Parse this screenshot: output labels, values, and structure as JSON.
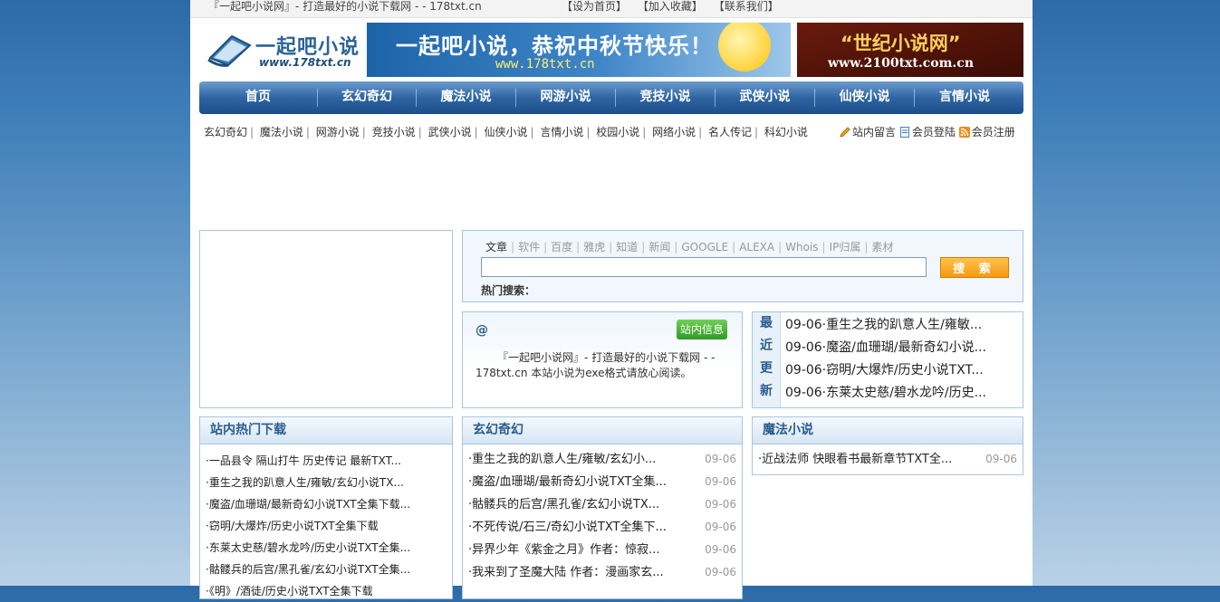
{
  "topbar": {
    "site_title": "『一起吧小说网』- 打造最好的小说下载网 - - 178txt.cn",
    "links": [
      "【设为首页】",
      "【加入收藏】",
      "【联系我们】"
    ]
  },
  "logo": {
    "brand": "一起吧小说",
    "url": "www.178txt.cn"
  },
  "banner1": {
    "headline": "一起吧小说，恭祝中秋节快乐！",
    "url": "www.178txt.cn"
  },
  "banner2": {
    "headline": "“世纪小说网”",
    "url": "www.2100txt.com.cn"
  },
  "nav": [
    "首页",
    "玄幻奇幻",
    "魔法小说",
    "网游小说",
    "竞技小说",
    "武侠小说",
    "仙侠小说",
    "言情小说"
  ],
  "categories": [
    "玄幻奇幻",
    "魔法小说",
    "网游小说",
    "竞技小说",
    "武侠小说",
    "仙侠小说",
    "言情小说",
    "校园小说",
    "网络小说",
    "名人传记",
    "科幻小说"
  ],
  "user_links": {
    "guestbook": "站内留言",
    "login": "会员登陆",
    "register": "会员注册"
  },
  "search": {
    "tabs": [
      "文章",
      "软件",
      "百度",
      "雅虎",
      "知道",
      "新闻",
      "GOOGLE",
      "ALEXA",
      "Whois",
      "IP归属",
      "素材"
    ],
    "input_value": "",
    "button": "搜 索",
    "hot_label": "热门搜索："
  },
  "site_info": {
    "at_symbol": "@",
    "badge": "站内信息",
    "description": "『一起吧小说网』- 打造最好的小说下载网 - - 178txt.cn 本站小说为exe格式请放心阅读。"
  },
  "recent": {
    "side_label": [
      "最",
      "近",
      "更",
      "新"
    ],
    "items": [
      "09-06·重生之我的趴意人生/雍敏...",
      "09-06·魔盗/血珊瑚/最新奇幻小说...",
      "09-06·窃明/大爆炸/历史小说TXT...",
      "09-06·东莱太史慈/碧水龙吟/历史..."
    ]
  },
  "hot_downloads": {
    "title": "站内热门下载",
    "items": [
      "·一品县令 隔山打牛 历史传记 最新TXT...",
      "·重生之我的趴意人生/雍敏/玄幻小说TX...",
      "·魔盗/血珊瑚/最新奇幻小说TXT全集下载...",
      "·窃明/大爆炸/历史小说TXT全集下载",
      "·东莱太史慈/碧水龙吟/历史小说TXT全集...",
      "·骷髅兵的后宫/黑孔雀/玄幻小说TXT全集...",
      "·《明》/酒徒/历史小说TXT全集下载"
    ]
  },
  "xuanhuan": {
    "title": "玄幻奇幻",
    "items": [
      {
        "title": "·重生之我的趴意人生/雍敏/玄幻小...",
        "date": "09-06"
      },
      {
        "title": "·魔盗/血珊瑚/最新奇幻小说TXT全集...",
        "date": "09-06"
      },
      {
        "title": "·骷髅兵的后宫/黑孔雀/玄幻小说TX...",
        "date": "09-06"
      },
      {
        "title": "·不死传说/石三/奇幻小说TXT全集下...",
        "date": "09-06"
      },
      {
        "title": "·异界少年《紫金之月》作者：惊寂...",
        "date": "09-06"
      },
      {
        "title": "·我来到了圣魔大陆 作者：漫画家玄...",
        "date": "09-06"
      }
    ]
  },
  "mofa": {
    "title": "魔法小说",
    "items": [
      {
        "title": "·近战法师 快眼看书最新章节TXT全...",
        "date": "09-06"
      }
    ]
  }
}
